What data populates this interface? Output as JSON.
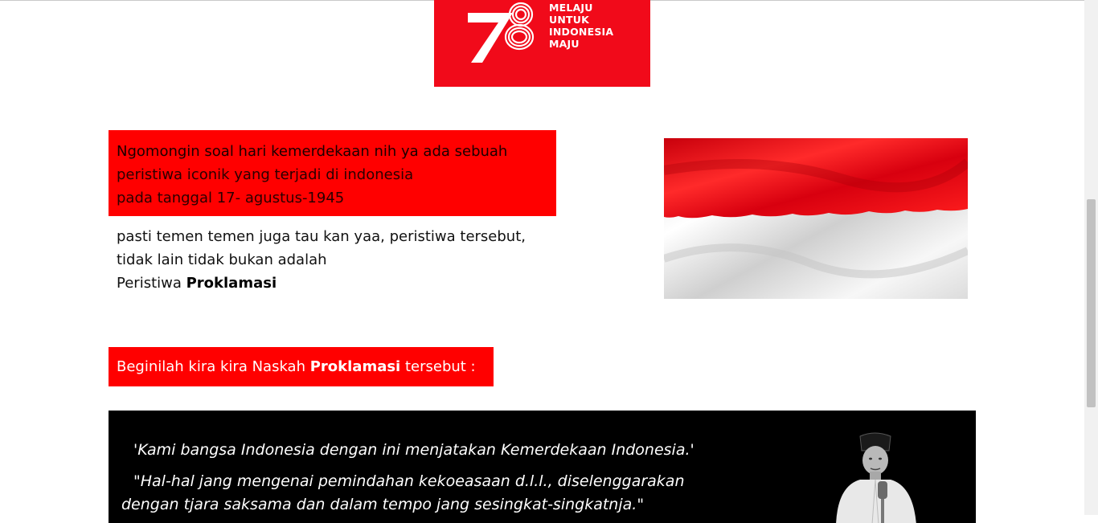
{
  "logo": {
    "number_graphic": "78",
    "lines": [
      "MELAJU",
      "UNTUK",
      "INDONESIA",
      "MAJU"
    ],
    "bg_color": "#f10a1a"
  },
  "intro": {
    "lines": [
      "Ngomongin soal hari kemerdekaan nih ya ada sebuah",
      "peristiwa iconik yang terjadi di indonesia",
      "pada tanggal 17- agustus-1945"
    ],
    "bg_color": "#ff0000"
  },
  "para2": {
    "line1": "pasti temen temen juga tau kan yaa, peristiwa tersebut,",
    "line2": "tidak lain tidak bukan adalah",
    "line3_prefix": "Peristiwa ",
    "line3_bold": "Proklamasi"
  },
  "flag": {
    "name": "indonesian-flag",
    "top_color": "#e8121a",
    "bottom_color": "#f2f2f2"
  },
  "naskah": {
    "prefix": "Beginilah kira kira Naskah ",
    "bold": "Proklamasi",
    "suffix": " tersebut :"
  },
  "quotes": {
    "q1": "'Kami bangsa Indonesia dengan ini menjatakan Kemerdekaan Indonesia.'",
    "q2": "\"Hal-hal jang mengenai pemindahan kekoeasaan d.l.l., diselenggarakan",
    "q3": "dengan tjara saksama dan dalam tempo jang sesingkat-singkatnja.\""
  }
}
